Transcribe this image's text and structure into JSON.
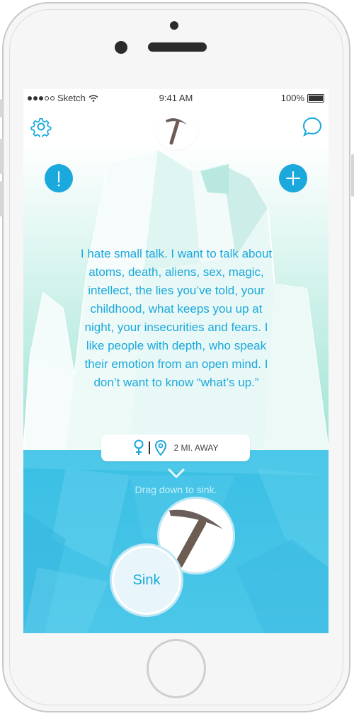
{
  "status_bar": {
    "carrier": "Sketch",
    "time": "9:41 AM",
    "battery": "100%"
  },
  "nav": {
    "settings_icon": "gear-icon",
    "chat_icon": "chat-bubble-icon",
    "logo_icon": "ice-pick-icon"
  },
  "actions": {
    "report_icon": "exclamation-icon",
    "add_icon": "plus-icon"
  },
  "profile": {
    "quote": "I hate small talk. I want to talk about atoms, death, aliens, sex, magic, intellect, the lies you’ve told, your childhood, what keeps you up at night, your insecurities and fears. I like people with depth, who speak their emotion from an open mind. I don’t want to know “what’s up.”",
    "gender_icon": "female-symbol-icon",
    "location_icon": "location-pin-icon",
    "distance": "2 MI. AWAY"
  },
  "hint": {
    "text": "Drag down to sink."
  },
  "buttons": {
    "sink_label": "Sink",
    "pick_icon": "ice-pick-icon"
  },
  "colors": {
    "accent": "#1ba8dc",
    "sky_top": "#ffffff",
    "sky_bottom": "#9fe4d6",
    "water": "#4cc4e6"
  }
}
